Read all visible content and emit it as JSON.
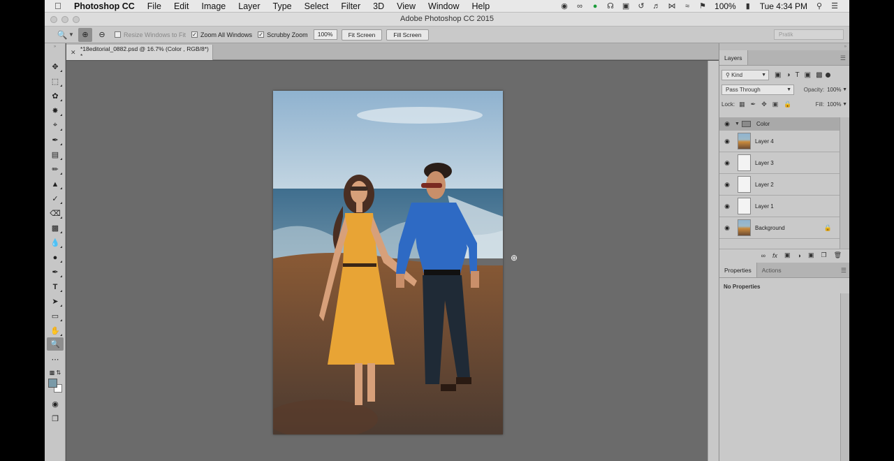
{
  "menubar": {
    "app_name": "Photoshop CC",
    "items": [
      "File",
      "Edit",
      "Image",
      "Layer",
      "Type",
      "Select",
      "Filter",
      "3D",
      "View",
      "Window",
      "Help"
    ],
    "battery": "100%",
    "clock": "Tue 4:34 PM"
  },
  "window": {
    "title": "Adobe Photoshop CC 2015"
  },
  "options": {
    "resize_windows": "Resize Windows to Fit",
    "zoom_all": "Zoom All Windows",
    "scrubby": "Scrubby Zoom",
    "zoom_value": "100%",
    "fit_screen": "Fit Screen",
    "fill_screen": "Fill Screen",
    "workspace": "Pratik"
  },
  "document": {
    "tab_title": "*18editorial_0882.psd @ 16.7% (Color , RGB/8*) *"
  },
  "layers_panel": {
    "tab": "Layers",
    "kind": "Kind",
    "blend_mode": "Pass Through",
    "opacity_label": "Opacity:",
    "opacity": "100%",
    "lock_label": "Lock:",
    "fill_label": "Fill:",
    "fill": "100%",
    "layers": [
      {
        "name": "Color",
        "type": "group"
      },
      {
        "name": "Layer 4",
        "type": "image"
      },
      {
        "name": "Layer 3",
        "type": "blank"
      },
      {
        "name": "Layer 2",
        "type": "blank"
      },
      {
        "name": "Layer 1",
        "type": "blank"
      },
      {
        "name": "Background",
        "type": "image",
        "locked": true
      }
    ]
  },
  "properties_panel": {
    "tab_properties": "Properties",
    "tab_actions": "Actions",
    "message": "No Properties"
  },
  "colors": {
    "foreground": "#7a9aa8",
    "background": "#ffffff"
  }
}
